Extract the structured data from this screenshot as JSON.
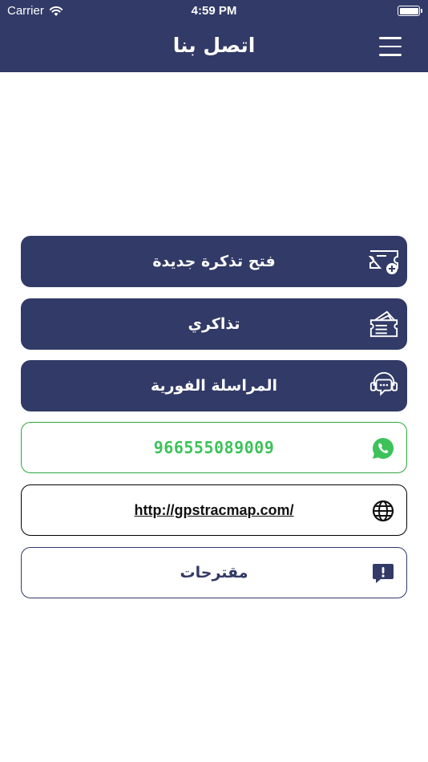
{
  "status_bar": {
    "carrier": "Carrier",
    "time": "4:59 PM"
  },
  "header": {
    "title": "اتصل بنا"
  },
  "actions": {
    "new_ticket": "فتح تذكرة جديدة",
    "my_tickets": "تذاكري",
    "live_chat": "المراسلة الفورية",
    "phone": "966555089009",
    "website": "http://gpstracmap.com/",
    "suggestions": "مقترحات"
  },
  "colors": {
    "primary": "#323a67",
    "whatsapp_green": "#3dc25a",
    "background": "#ffffff"
  },
  "icons": {
    "menu": "hamburger-icon",
    "new_ticket": "ticket-plus-icon",
    "my_tickets": "tickets-stack-icon",
    "live_chat": "headset-chat-icon",
    "phone": "whatsapp-icon",
    "website": "globe-icon",
    "suggestions": "feedback-bubble-icon"
  }
}
